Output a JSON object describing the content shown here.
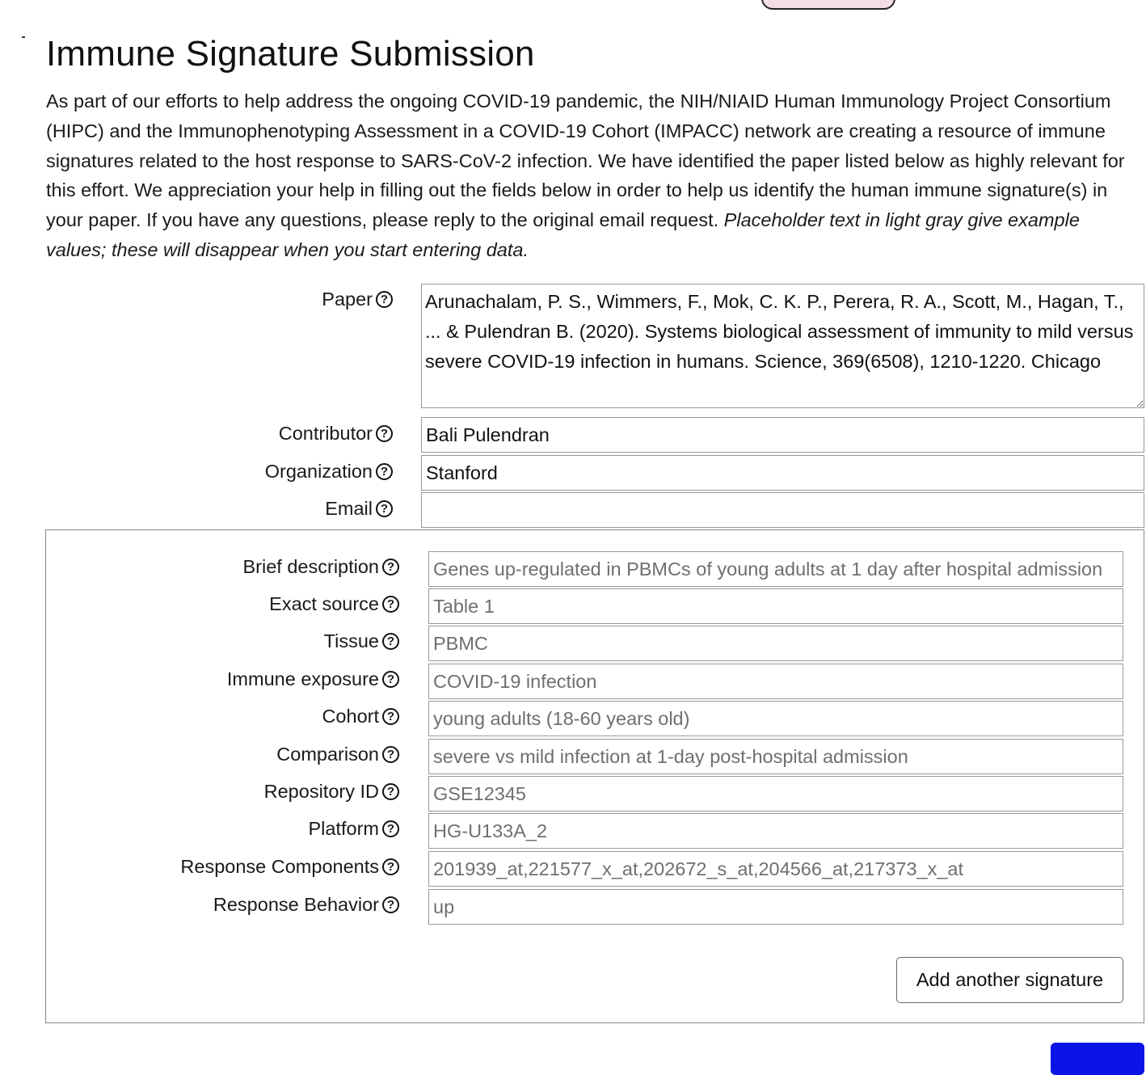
{
  "page": {
    "title": "Immune Signature Submission",
    "intro": "As part of our efforts to help address the ongoing COVID-19 pandemic, the NIH/NIAID Human Immunology Project Consortium (HIPC) and the Immunophenotyping Assessment in a COVID-19 Cohort (IMPACC) network are creating a resource of immune signatures related to the host response to SARS-CoV-2 infection. We have identified the paper listed below as highly relevant for this effort. We appreciation your help in filling out the fields below in order to help us identify the human immune signature(s) in your paper. If you have any questions, please reply to the original email request.",
    "intro_italic": "Placeholder text in light gray give example values; these will disappear when you start entering data.",
    "help_glyph": "?",
    "help_icon": "question-circle-icon"
  },
  "paper": {
    "label": "Paper",
    "value": "Arunachalam, P. S., Wimmers, F., Mok, C. K. P., Perera, R. A., Scott, M., Hagan, T., ... & Pulendran B. (2020). Systems biological assessment of immunity to mild versus severe COVID-19 infection in humans. Science, 369(6508), 1210-1220. Chicago"
  },
  "contributor": {
    "label": "Contributor",
    "value": "Bali Pulendran"
  },
  "organization": {
    "label": "Organization",
    "value": "Stanford"
  },
  "email": {
    "label": "Email",
    "value": ""
  },
  "signature": {
    "brief_description": {
      "label": "Brief description",
      "placeholder": "Genes up-regulated in PBMCs of young adults at 1 day after hospital admission"
    },
    "exact_source": {
      "label": "Exact source",
      "placeholder": "Table 1"
    },
    "tissue": {
      "label": "Tissue",
      "placeholder": "PBMC"
    },
    "immune_exposure": {
      "label": "Immune exposure",
      "placeholder": "COVID-19 infection"
    },
    "cohort": {
      "label": "Cohort",
      "placeholder": "young adults (18-60 years old)"
    },
    "comparison": {
      "label": "Comparison",
      "placeholder": "severe vs mild infection at 1-day post-hospital admission"
    },
    "repository_id": {
      "label": "Repository ID",
      "placeholder": "GSE12345"
    },
    "platform": {
      "label": "Platform",
      "placeholder": "HG-U133A_2"
    },
    "response_components": {
      "label": "Response Components",
      "placeholder": "201939_at,221577_x_at,202672_s_at,204566_at,217373_x_at"
    },
    "response_behavior": {
      "label": "Response Behavior",
      "placeholder": "up"
    },
    "add_button_label": "Add another signature"
  },
  "colors": {
    "submit_button": "#0a14e6",
    "top_tab": "#f3dde6",
    "placeholder_text": "#6f6f6f"
  }
}
